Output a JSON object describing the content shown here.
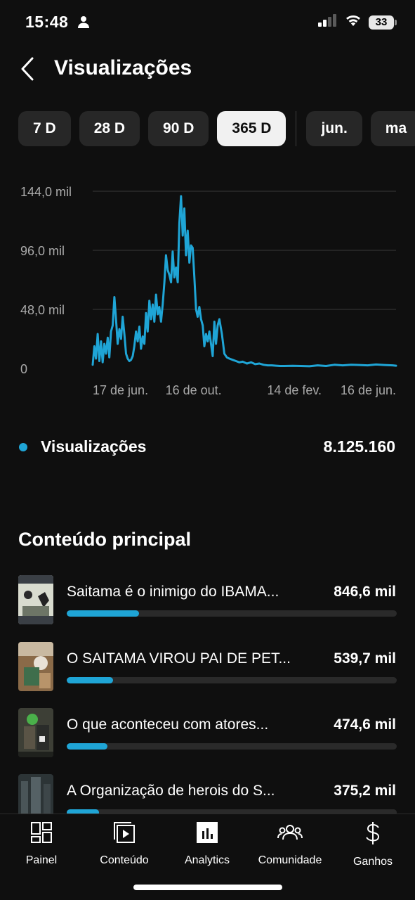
{
  "status_bar": {
    "time": "15:48",
    "person_icon": "person-icon",
    "signal_icon": "cellular-signal-icon",
    "wifi_icon": "wifi-icon",
    "battery_level": "33"
  },
  "header": {
    "back_icon": "chevron-left-icon",
    "title": "Visualizações"
  },
  "period_chips": {
    "items": [
      {
        "label": "7 D",
        "active": false
      },
      {
        "label": "28 D",
        "active": false
      },
      {
        "label": "90 D",
        "active": false
      },
      {
        "label": "365 D",
        "active": true
      },
      {
        "label": "jun.",
        "active": false
      },
      {
        "label": "ma",
        "active": false
      }
    ]
  },
  "chart_data": {
    "type": "line",
    "y_tick_labels": [
      "144,0 mil",
      "96,0 mil",
      "48,0 mil",
      "0"
    ],
    "y_ticks": [
      144000,
      96000,
      48000,
      0
    ],
    "ylim": [
      0,
      144000
    ],
    "x_tick_labels": [
      "17 de jun.",
      "16 de out.",
      "14 de fev.",
      "16 de jun."
    ],
    "x_tick_days": [
      0,
      121,
      242,
      364
    ],
    "xlim": [
      0,
      364
    ],
    "series": [
      {
        "color": "#1fa5d6",
        "x": [
          0,
          2,
          4,
          6,
          8,
          10,
          12,
          14,
          16,
          18,
          20,
          22,
          24,
          26,
          28,
          30,
          32,
          34,
          36,
          38,
          40,
          42,
          44,
          46,
          48,
          50,
          52,
          54,
          56,
          58,
          60,
          62,
          64,
          66,
          68,
          70,
          72,
          74,
          76,
          78,
          80,
          82,
          84,
          86,
          88,
          90,
          92,
          94,
          96,
          98,
          100,
          102,
          104,
          106,
          108,
          110,
          112,
          114,
          116,
          118,
          120,
          122,
          124,
          126,
          128,
          130,
          132,
          134,
          136,
          138,
          140,
          142,
          144,
          146,
          148,
          150,
          152,
          155,
          158,
          161,
          164,
          168,
          172,
          176,
          180,
          185,
          190,
          195,
          200,
          205,
          210,
          215,
          220,
          225,
          230,
          240,
          250,
          260,
          270,
          280,
          290,
          300,
          310,
          320,
          330,
          340,
          350,
          360,
          364
        ],
        "y": [
          3000,
          18000,
          8000,
          28000,
          6000,
          22000,
          5000,
          20000,
          12000,
          25000,
          9000,
          30000,
          35000,
          58000,
          40000,
          20000,
          32000,
          24000,
          42000,
          28000,
          12000,
          8000,
          6000,
          7000,
          10000,
          18000,
          30000,
          22000,
          34000,
          16000,
          26000,
          20000,
          45000,
          30000,
          55000,
          40000,
          52000,
          38000,
          60000,
          44000,
          50000,
          38000,
          52000,
          70000,
          92000,
          80000,
          76000,
          70000,
          95000,
          74000,
          82000,
          70000,
          118000,
          140000,
          108000,
          130000,
          92000,
          112000,
          86000,
          100000,
          98000,
          74000,
          48000,
          42000,
          50000,
          40000,
          35000,
          18000,
          28000,
          22000,
          30000,
          20000,
          10000,
          38000,
          20000,
          35000,
          40000,
          28000,
          12000,
          9000,
          8000,
          7000,
          6000,
          5000,
          5500,
          4000,
          5000,
          3500,
          4000,
          3000,
          2500,
          2500,
          2200,
          2000,
          2000,
          2100,
          2000,
          1800,
          2500,
          2000,
          3000,
          2500,
          3000,
          2800,
          2500,
          3200,
          2800,
          2500,
          2200
        ]
      }
    ],
    "grid": true
  },
  "metric": {
    "label": "Visualizações",
    "value": "8.125.160",
    "dot_color": "#1fa5d6"
  },
  "top_content": {
    "title": "Conteúdo principal",
    "items": [
      {
        "title": "Saitama é o inimigo do IBAMA...",
        "value": "846,6 mil",
        "share": 0.22
      },
      {
        "title": "O SAITAMA VIROU PAI DE PET...",
        "value": "539,7 mil",
        "share": 0.14
      },
      {
        "title": "O que aconteceu com atores...",
        "value": "474,6 mil",
        "share": 0.123
      },
      {
        "title": "A Organização de herois do S...",
        "value": "375,2 mil",
        "share": 0.097
      }
    ]
  },
  "bottom_nav": {
    "items": [
      {
        "label": "Painel",
        "icon": "dashboard-icon"
      },
      {
        "label": "Conteúdo",
        "icon": "content-play-icon"
      },
      {
        "label": "Analytics",
        "icon": "analytics-icon",
        "active": true
      },
      {
        "label": "Comunidade",
        "icon": "community-icon"
      },
      {
        "label": "Ganhos",
        "icon": "dollar-icon"
      }
    ]
  }
}
